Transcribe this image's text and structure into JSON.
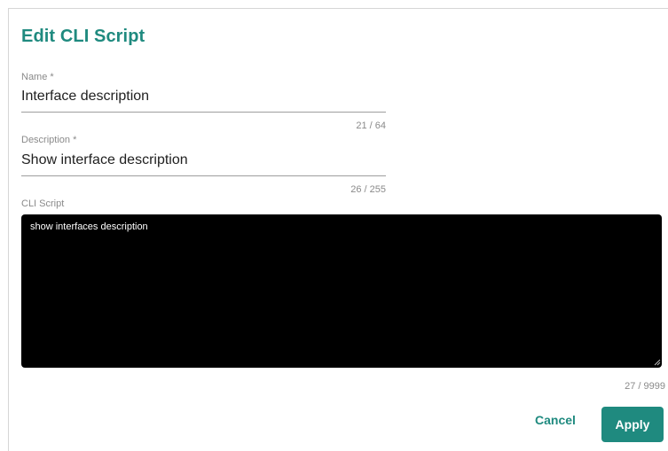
{
  "dialog": {
    "title": "Edit CLI Script"
  },
  "name_field": {
    "label": "Name *",
    "value": "Interface description",
    "counter": "21 / 64"
  },
  "description_field": {
    "label": "Description *",
    "value": "Show interface description",
    "counter": "26 / 255"
  },
  "cli_script_field": {
    "label": "CLI Script",
    "value": "show interfaces description",
    "counter": "27 / 9999"
  },
  "actions": {
    "cancel_label": "Cancel",
    "apply_label": "Apply"
  },
  "colors": {
    "accent": "#1f8a7f",
    "script_background": "#000000"
  }
}
